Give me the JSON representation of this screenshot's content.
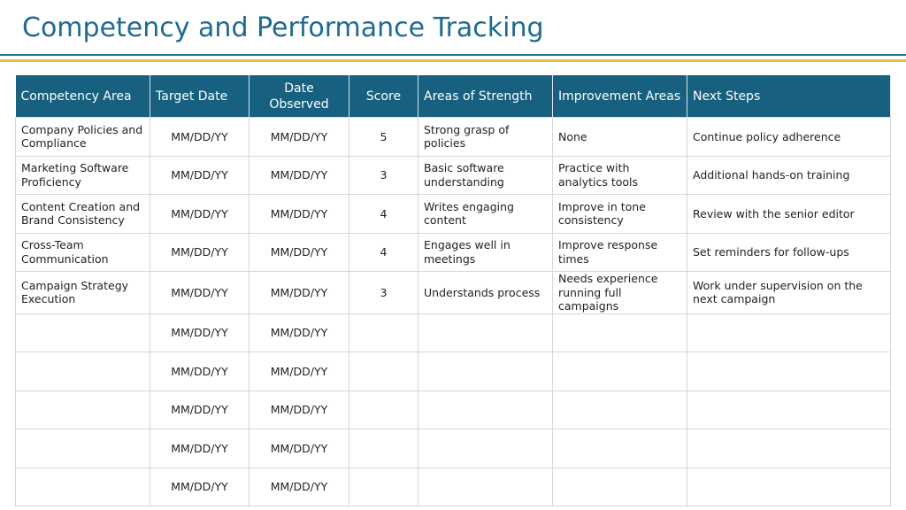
{
  "title": "Competency and Performance Tracking",
  "headers": {
    "competency_area": "Competency Area",
    "target_date": "Target Date",
    "date_observed": "Date Observed",
    "score": "Score",
    "areas_of_strength": "Areas of Strength",
    "improvement_areas": "Improvement Areas",
    "next_steps": "Next Steps"
  },
  "rows": [
    {
      "competency": "Company Policies and Compliance",
      "target": "MM/DD/YY",
      "observed": "MM/DD/YY",
      "score": "5",
      "strength": "Strong grasp of policies",
      "improvement": "None",
      "next": "Continue policy adherence"
    },
    {
      "competency": "Marketing Software Proficiency",
      "target": "MM/DD/YY",
      "observed": "MM/DD/YY",
      "score": "3",
      "strength": "Basic software understanding",
      "improvement": "Practice with analytics tools",
      "next": "Additional hands-on training"
    },
    {
      "competency": "Content Creation and Brand Consistency",
      "target": "MM/DD/YY",
      "observed": "MM/DD/YY",
      "score": "4",
      "strength": "Writes engaging content",
      "improvement": "Improve in tone consistency",
      "next": "Review with the senior editor"
    },
    {
      "competency": "Cross-Team Communication",
      "target": "MM/DD/YY",
      "observed": "MM/DD/YY",
      "score": "4",
      "strength": "Engages well in meetings",
      "improvement": "Improve response times",
      "next": "Set reminders for follow-ups"
    },
    {
      "competency": "Campaign Strategy Execution",
      "target": "MM/DD/YY",
      "observed": "MM/DD/YY",
      "score": "3",
      "strength": "Understands process",
      "improvement": "Needs experience running full campaigns",
      "next": "Work under supervision on the next campaign"
    },
    {
      "competency": "",
      "target": "MM/DD/YY",
      "observed": "MM/DD/YY",
      "score": "",
      "strength": "",
      "improvement": "",
      "next": ""
    },
    {
      "competency": "",
      "target": "MM/DD/YY",
      "observed": "MM/DD/YY",
      "score": "",
      "strength": "",
      "improvement": "",
      "next": ""
    },
    {
      "competency": "",
      "target": "MM/DD/YY",
      "observed": "MM/DD/YY",
      "score": "",
      "strength": "",
      "improvement": "",
      "next": ""
    },
    {
      "competency": "",
      "target": "MM/DD/YY",
      "observed": "MM/DD/YY",
      "score": "",
      "strength": "",
      "improvement": "",
      "next": ""
    },
    {
      "competency": "",
      "target": "MM/DD/YY",
      "observed": "MM/DD/YY",
      "score": "",
      "strength": "",
      "improvement": "",
      "next": ""
    }
  ]
}
